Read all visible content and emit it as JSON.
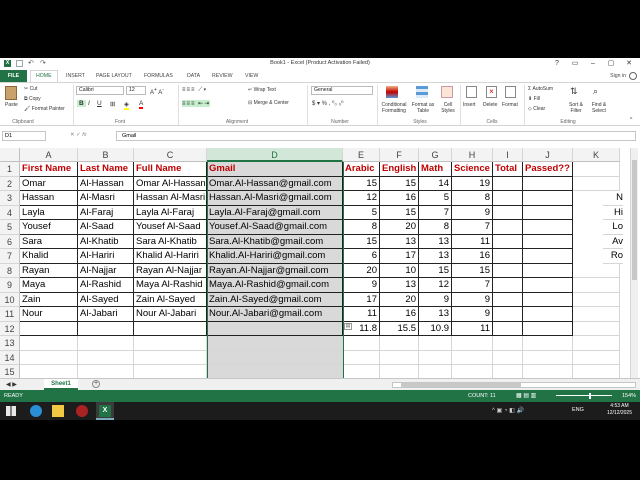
{
  "window": {
    "title": "Book1 - Excel (Product Activation Failed)",
    "signin": "Sign in"
  },
  "tabs": [
    "FILE",
    "HOME",
    "INSERT",
    "PAGE LAYOUT",
    "FORMULAS",
    "DATA",
    "REVIEW",
    "VIEW"
  ],
  "ribbon": {
    "clipboard": {
      "paste": "Paste",
      "cut": "Cut",
      "copy": "Copy",
      "format_painter": "Format Painter",
      "label": "Clipboard"
    },
    "font": {
      "name": "Calibri",
      "size": "12",
      "label": "Font"
    },
    "alignment": {
      "wrap": "Wrap Text",
      "merge": "Merge & Center",
      "label": "Alignment"
    },
    "number": {
      "format": "General",
      "label": "Number"
    },
    "styles": {
      "conditional": "Conditional Formatting",
      "format_table": "Format as Table",
      "cell_styles": "Cell Styles",
      "label": "Styles"
    },
    "cells": {
      "insert": "Insert",
      "delete": "Delete",
      "format": "Format",
      "label": "Cells"
    },
    "editing": {
      "autosum": "AutoSum",
      "fill": "Fill",
      "clear": "Clear",
      "sort": "Sort & Filter",
      "find": "Find & Select",
      "label": "Editing"
    }
  },
  "formula_bar": {
    "name_box": "D1",
    "content": "Gmail"
  },
  "columns": [
    "A",
    "B",
    "C",
    "D",
    "E",
    "F",
    "G",
    "H",
    "I",
    "J",
    "K"
  ],
  "rows": [
    "1",
    "2",
    "3",
    "4",
    "5",
    "6",
    "7",
    "8",
    "9",
    "10",
    "11",
    "12",
    "13",
    "14",
    "15"
  ],
  "sheet": {
    "headers": [
      "First Name",
      "Last Name",
      "Full Name",
      "Gmail",
      "Arabic",
      "English",
      "Math",
      "Science",
      "Total",
      "Passed??"
    ],
    "data": [
      [
        "Omar",
        "Al-Hassan",
        "Omar Al-Hassan",
        "Omar.Al-Hassan@gmail.com",
        "15",
        "15",
        "14",
        "19"
      ],
      [
        "Hassan",
        "Al-Masri",
        "Hassan Al-Masri",
        "Hassan.Al-Masri@gmail.com",
        "12",
        "16",
        "5",
        "8"
      ],
      [
        "Layla",
        "Al-Faraj",
        "Layla Al-Faraj",
        "Layla.Al-Faraj@gmail.com",
        "5",
        "15",
        "7",
        "9"
      ],
      [
        "Yousef",
        "Al-Saad",
        "Yousef Al-Saad",
        "Yousef.Al-Saad@gmail.com",
        "8",
        "20",
        "8",
        "7"
      ],
      [
        "Sara",
        "Al-Khatib",
        "Sara Al-Khatib",
        "Sara.Al-Khatib@gmail.com",
        "15",
        "13",
        "13",
        "11"
      ],
      [
        "Khalid",
        "Al-Hariri",
        "Khalid Al-Hariri",
        "Khalid.Al-Hariri@gmail.com",
        "6",
        "17",
        "13",
        "16"
      ],
      [
        "Rayan",
        "Al-Najjar",
        "Rayan Al-Najjar",
        "Rayan.Al-Najjar@gmail.com",
        "20",
        "10",
        "15",
        "15"
      ],
      [
        "Maya",
        "Al-Rashid",
        "Maya Al-Rashid",
        "Maya.Al-Rashid@gmail.com",
        "9",
        "13",
        "12",
        "7"
      ],
      [
        "Zain",
        "Al-Sayed",
        "Zain Al-Sayed",
        "Zain.Al-Sayed@gmail.com",
        "17",
        "20",
        "9",
        "9"
      ],
      [
        "Nour",
        "Al-Jabari",
        "Nour Al-Jabari",
        "Nour.Al-Jabari@gmail.com",
        "11",
        "16",
        "13",
        "9"
      ]
    ],
    "averages": [
      "11.8",
      "15.5",
      "10.9",
      "11"
    ],
    "k_partial": [
      "N",
      "Hi",
      "Lo",
      "Av",
      "Ro"
    ]
  },
  "sheet_tab": "Sheet1",
  "status": {
    "ready": "READY",
    "count": "COUNT: 11",
    "zoom": "154%"
  },
  "taskbar": {
    "lang": "ENG",
    "time": "4:53 AM",
    "date": "12/12/2025"
  },
  "colors": {
    "excel_green": "#217346",
    "header_red": "#c00000",
    "selection_gray": "#d9d9d9"
  }
}
